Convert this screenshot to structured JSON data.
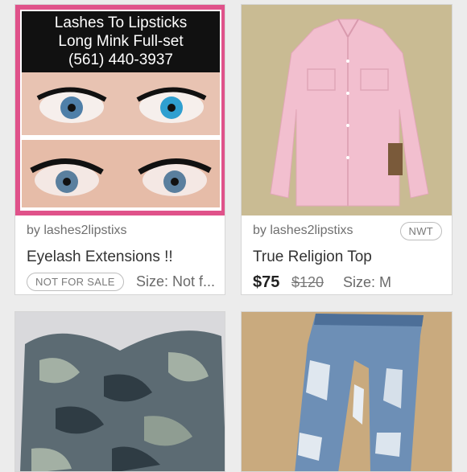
{
  "listings": [
    {
      "photo_text": {
        "line1": "Lashes To Lipsticks",
        "line2": "Long Mink Full-set",
        "line3": "(561) 440-3937"
      },
      "seller": "by lashes2lipstixs",
      "title": "Eyelash Extensions !!",
      "badge": "NOT FOR SALE",
      "size": "Size: Not f..."
    },
    {
      "seller": "by lashes2lipstixs",
      "condition": "NWT",
      "title": "True Religion Top",
      "price": "$75",
      "original_price": "$120",
      "size": "Size: M"
    },
    {
      "description": "camo strapless top"
    },
    {
      "description": "distressed jeans"
    }
  ],
  "colors": {
    "background": "#ececec",
    "photo_border_pink": "#e0528a",
    "shirt_pink": "#f2bfcf"
  }
}
